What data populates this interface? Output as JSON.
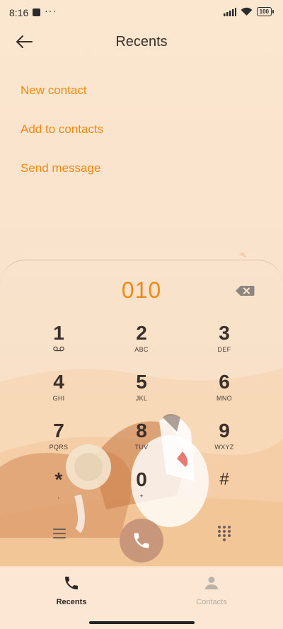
{
  "status_bar": {
    "time": "8:16",
    "dots": "···",
    "battery": "100"
  },
  "header": {
    "title": "Recents"
  },
  "menu": {
    "items": [
      "New contact",
      "Add to contacts",
      "Send message"
    ]
  },
  "dialer": {
    "number": "010",
    "keys": [
      {
        "digit": "1",
        "letters": ""
      },
      {
        "digit": "2",
        "letters": "ABC"
      },
      {
        "digit": "3",
        "letters": "DEF"
      },
      {
        "digit": "4",
        "letters": "GHI"
      },
      {
        "digit": "5",
        "letters": "JKL"
      },
      {
        "digit": "6",
        "letters": "MNO"
      },
      {
        "digit": "7",
        "letters": "PQRS"
      },
      {
        "digit": "8",
        "letters": "TUV"
      },
      {
        "digit": "9",
        "letters": "WXYZ"
      },
      {
        "digit": "*",
        "letters": ","
      },
      {
        "digit": "0",
        "letters": "+"
      },
      {
        "digit": "#",
        "letters": ""
      }
    ]
  },
  "bottom_nav": {
    "tabs": [
      {
        "label": "Recents",
        "active": true
      },
      {
        "label": "Contacts",
        "active": false
      }
    ]
  },
  "colors": {
    "accent": "#f08a12",
    "call_button": "#c8967a",
    "background": "#fbe6d0"
  }
}
